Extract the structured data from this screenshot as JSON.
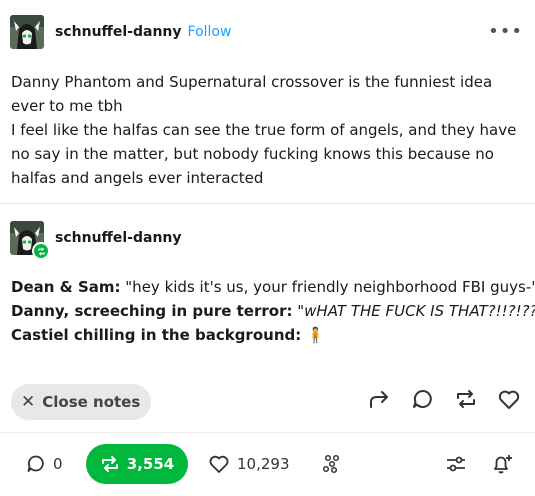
{
  "post": {
    "blog_name": "schnuffel-danny",
    "follow_label": "Follow",
    "more_label": "•••",
    "op_paragraphs": [
      "Danny Phantom and Supernatural crossover is the funniest idea ever to me tbh",
      "I feel like the halfas can see the true form of angels, and they have no say in the matter, but nobody fucking knows this because no halfas and angels ever interacted"
    ]
  },
  "reblog": {
    "blog_name": "schnuffel-danny",
    "lines": [
      {
        "speaker": "Dean & Sam:",
        "text": " \"hey kids it's us, your friendly neighborhood FBI guys-\""
      },
      {
        "speaker": "Danny, screeching in pure terror:",
        "text_pre": " \"",
        "text_italic": "wHAT THE FUCK IS THAT?!!?!???!",
        "text_post": "\""
      },
      {
        "speaker": "Castiel chilling in the background:",
        "emoji": "🧍"
      }
    ]
  },
  "notes": {
    "close_label": "Close notes",
    "close_icon": "x-icon"
  },
  "footer": {
    "replies": "0",
    "reblogs": "3,554",
    "likes": "10,293"
  },
  "colors": {
    "accent_green": "#00b83b",
    "follow_blue": "#1da1ff"
  }
}
